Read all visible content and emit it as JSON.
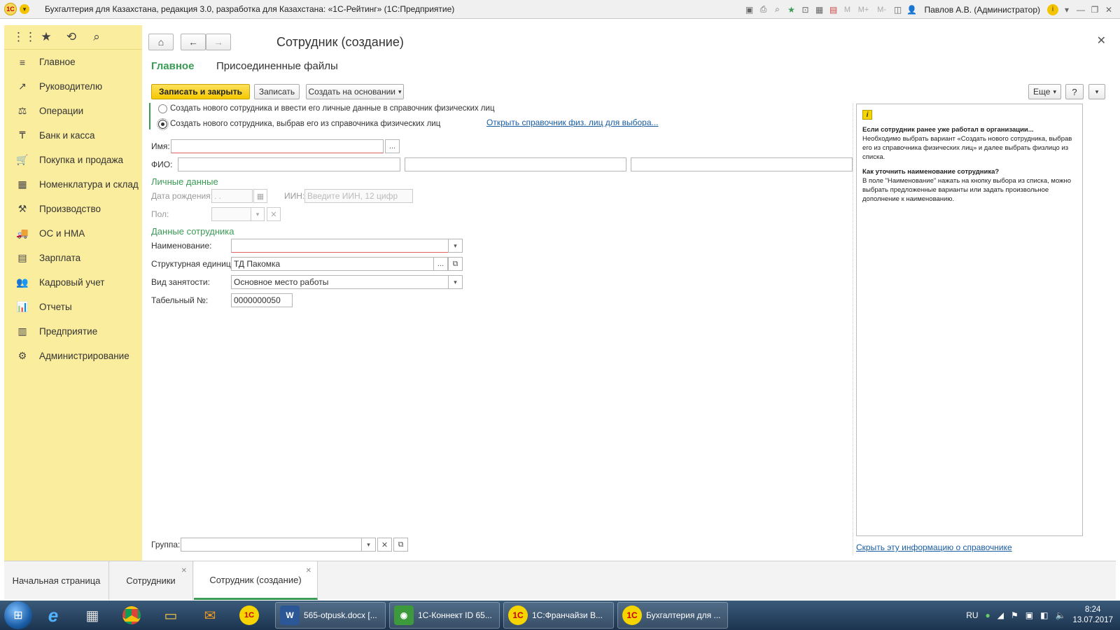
{
  "titlebar": {
    "logo": "1С",
    "title": "Бухгалтерия для Казахстана, редакция 3.0, разработка для Казахстана: «1С-Рейтинг»  (1С:Предприятие)",
    "user": "Павлов А.В. (Администратор)",
    "m_labels": [
      "M",
      "M+",
      "M-"
    ]
  },
  "sidebar": {
    "items": [
      {
        "icon": "≡",
        "label": "Главное"
      },
      {
        "icon": "↗",
        "label": "Руководителю"
      },
      {
        "icon": "⚖",
        "label": "Операции"
      },
      {
        "icon": "₸",
        "label": "Банк и касса"
      },
      {
        "icon": "🛒",
        "label": "Покупка и продажа"
      },
      {
        "icon": "▦",
        "label": "Номенклатура и склад"
      },
      {
        "icon": "⚒",
        "label": "Производство"
      },
      {
        "icon": "🚚",
        "label": "ОС и НМА"
      },
      {
        "icon": "▤",
        "label": "Зарплата"
      },
      {
        "icon": "👥",
        "label": "Кадровый учет"
      },
      {
        "icon": "📊",
        "label": "Отчеты"
      },
      {
        "icon": "▥",
        "label": "Предприятие"
      },
      {
        "icon": "⚙",
        "label": "Администрирование"
      }
    ]
  },
  "form": {
    "title": "Сотрудник (создание)",
    "tab_main": "Главное",
    "tab_files": "Присоединенные файлы",
    "btn_save_close": "Записать и закрыть",
    "btn_save": "Записать",
    "btn_create_based": "Создать на основании",
    "btn_more": "Еще",
    "btn_help": "?",
    "radio1": "Создать нового сотрудника и ввести его личные данные в справочник физических лиц",
    "radio2": "Создать нового сотрудника, выбрав его из справочника физических лиц",
    "link_open_ref": "Открыть справочник физ. лиц для выбора...",
    "label_name": "Имя:",
    "label_fio": "ФИО:",
    "section_personal": "Личные данные",
    "label_birth": "Дата рождения:",
    "birth_value": " .  .",
    "label_iin": "ИИН:",
    "iin_placeholder": "Введите ИИН, 12 цифр",
    "label_gender": "Пол:",
    "section_employee": "Данные сотрудника",
    "label_title": "Наименование:",
    "label_unit": "Структурная единица:",
    "unit_value": "ТД Пакомка",
    "label_employment": "Вид занятости:",
    "employment_value": "Основное место работы",
    "label_tabnum": "Табельный №:",
    "tabnum_value": "0000000050",
    "label_group": "Группа:",
    "link_hide_info": "Скрыть эту информацию о справочнике"
  },
  "info": {
    "h1": "Если сотрудник ранее уже работал в организации...",
    "t1": "Необходимо выбрать вариант «Создать нового сотрудника, выбрав его из справочника физических лиц» и далее выбрать физлицо из списка.",
    "h2": "Как уточнить наименование сотрудника?",
    "t2": "В поле \"Наименование\" нажать на кнопку выбора из списка, можно выбрать предложенные варианты или задать произвольное дополнение к наименованию."
  },
  "open_tabs": [
    {
      "label": "Начальная страница"
    },
    {
      "label": "Сотрудники"
    },
    {
      "label": "Сотрудник (создание)"
    }
  ],
  "taskbar": {
    "tasks": [
      {
        "icon": "W",
        "label": "565-otpusk.docx [..."
      },
      {
        "icon": "◉",
        "label": "1С-Коннект ID 65..."
      },
      {
        "icon": "1С",
        "label": "1С:Франчайзи В..."
      },
      {
        "icon": "1С",
        "label": "Бухгалтерия для ..."
      }
    ],
    "lang": "RU",
    "time": "8:24",
    "date": "13.07.2017"
  }
}
